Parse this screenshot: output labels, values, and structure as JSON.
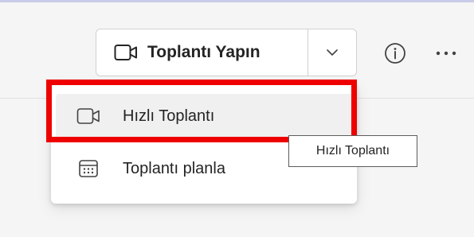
{
  "toolbar": {
    "meet_button_label": "Toplantı Yapın",
    "meet_icon": "video-camera-icon",
    "dropdown_icon": "chevron-down-icon",
    "info_icon": "info-icon",
    "more_icon": "more-options-icon"
  },
  "menu": {
    "items": [
      {
        "label": "Hızlı Toplantı",
        "icon": "video-camera-icon",
        "hovered": true
      },
      {
        "label": "Toplantı planla",
        "icon": "calendar-icon",
        "hovered": false
      }
    ]
  },
  "tooltip": {
    "text": "Hızlı Toplantı"
  },
  "colors": {
    "highlight": "#ee0000",
    "top_rule": "#c9cbe8",
    "menu_hover": "#f0f0f0"
  }
}
